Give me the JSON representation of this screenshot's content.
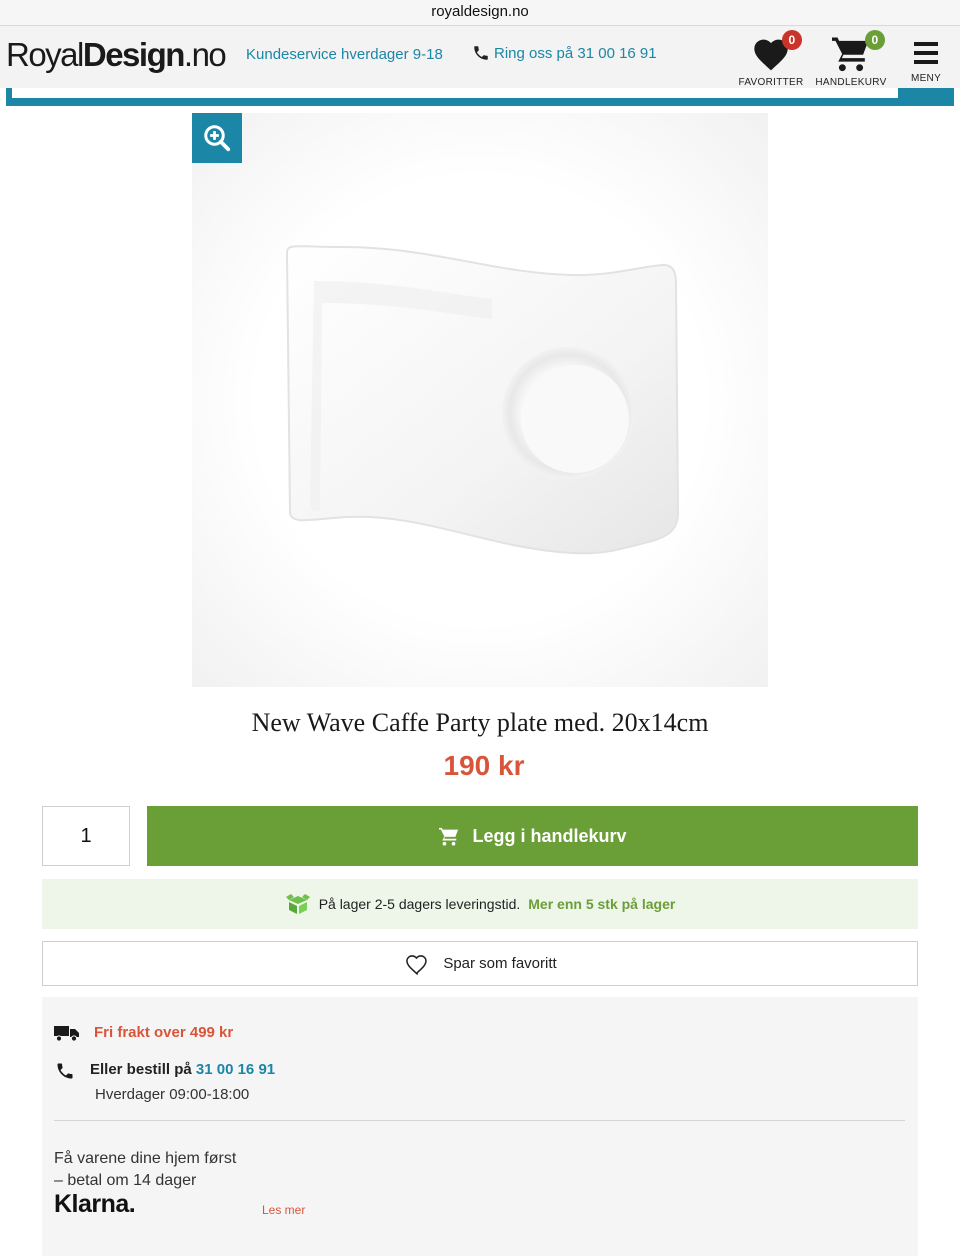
{
  "browser": {
    "url": "royaldesign.no"
  },
  "header": {
    "logo": {
      "part1": "Royal",
      "part2": "Design",
      "part3": ".no"
    },
    "service_text": "Kundeservice hverdager 9-18",
    "phone_text": "Ring oss på 31 00 16 91",
    "favorites": {
      "label": "FAVORITTER",
      "count": "0",
      "badge_color": "#c8342a",
      "icon": "heart-icon"
    },
    "cart": {
      "label": "HANDLEKURV",
      "count": "0",
      "badge_color": "#6a9e36",
      "icon": "cart-icon"
    },
    "menu": {
      "label": "MENY",
      "icon": "hamburger-icon"
    }
  },
  "product": {
    "title": "New Wave Caffe Party plate med. 20x14cm",
    "price": "190 kr",
    "quantity": "1",
    "add_to_cart_label": "Legg i handlekurv",
    "stock_text": "På lager 2-5 dagers leveringstid.",
    "stock_more": "Mer enn 5 stk på lager",
    "favorite_label": "Spar som favoritt"
  },
  "info": {
    "freight": "Fri frakt over 499 kr",
    "order_label": "Eller bestill på",
    "order_phone": "31 00 16 91",
    "hours": "Hverdager 09:00-18:00",
    "klarna_line1": "Få varene dine hjem først",
    "klarna_line2": "– betal om 14 dager",
    "klarna_logo": "Klarna.",
    "read_more": "Les mer"
  },
  "colors": {
    "accent": "#1b86a6",
    "price": "#d9553a",
    "cta": "#6a9e36"
  }
}
